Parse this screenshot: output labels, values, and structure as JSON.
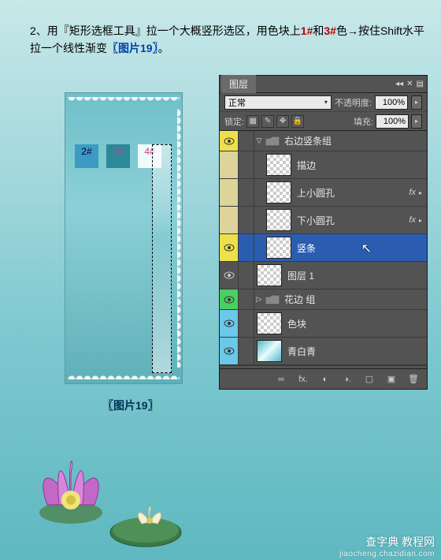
{
  "instruction": {
    "step_number": "2、",
    "text1": "用『矩形选框工具』拉一个大概竖形选区，用色块上",
    "red1": "1#",
    "text2": "和",
    "red2": "3#",
    "text3": "色→按住Shift水平拉一个线性渐变",
    "blue1": "〖图片19〗",
    "text4": "。"
  },
  "swatches": {
    "s2": "2#",
    "s3": "3#",
    "s4": "4#"
  },
  "caption": "〖图片19〗",
  "panel": {
    "title": "图层",
    "blend_label": "正常",
    "opacity_label": "不透明度:",
    "opacity_value": "100%",
    "lock_label": "锁定:",
    "fill_label": "填充:",
    "fill_value": "100%"
  },
  "layers": {
    "group1": "右边竖条组",
    "l_stroke": "描边",
    "l_hole_t": "上小圆孔",
    "l_hole_b": "下小圆孔",
    "l_bar": "竖条",
    "l_layer1": "图层 1",
    "group2": "花边 组",
    "l_block": "色块",
    "l_grad": "青白青",
    "fx": "fx"
  },
  "footer": {
    "link": "∞",
    "fx": "fx.",
    "mask": "◐",
    "adj": "◑.",
    "folder": "▢",
    "new": "▣",
    "trash": "🗑"
  },
  "watermark": {
    "site": "查字典 教程网",
    "url": "jiaocheng.chazidian.com"
  }
}
